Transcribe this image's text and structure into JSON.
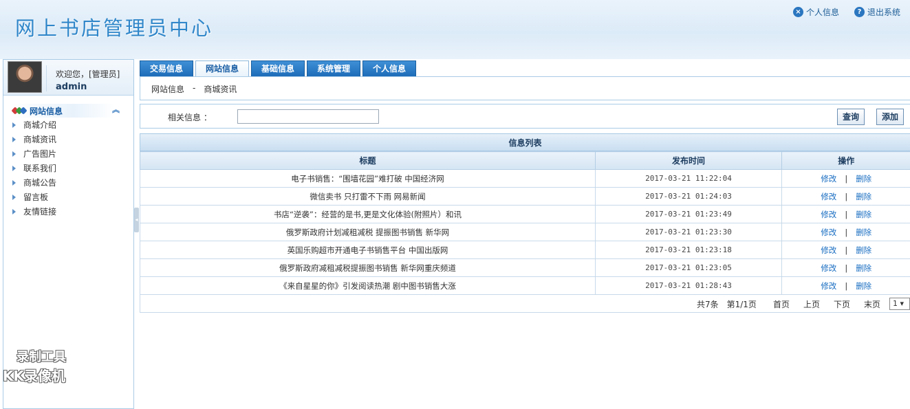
{
  "header": {
    "title": "网上书店管理员中心",
    "links": [
      {
        "label": "个人信息",
        "icon": "close-circle-icon"
      },
      {
        "label": "退出系统",
        "icon": "help-circle-icon"
      }
    ]
  },
  "user": {
    "welcome": "欢迎您，[管理员]",
    "name": "admin"
  },
  "sidebar": {
    "section": "网站信息",
    "items": [
      {
        "label": "商城介绍"
      },
      {
        "label": "商城资讯"
      },
      {
        "label": "广告图片"
      },
      {
        "label": "联系我们"
      },
      {
        "label": "商城公告"
      },
      {
        "label": "留言板"
      },
      {
        "label": "友情链接"
      }
    ]
  },
  "tabs": [
    {
      "label": "交易信息",
      "active": false
    },
    {
      "label": "网站信息",
      "active": true
    },
    {
      "label": "基础信息",
      "active": false
    },
    {
      "label": "系统管理",
      "active": false
    },
    {
      "label": "个人信息",
      "active": false
    }
  ],
  "breadcrumb": {
    "parent": "网站信息",
    "sep": "-",
    "current": "商城资讯"
  },
  "search": {
    "label": "相关信息 ：",
    "value": "",
    "query_label": "查询",
    "add_label": "添加"
  },
  "table": {
    "caption": "信息列表",
    "columns": [
      "标题",
      "发布时间",
      "操作"
    ],
    "rows": [
      {
        "title": "电子书销售：“围墙花园”难打破 中国经济网",
        "time": "2017-03-21 11:22:04"
      },
      {
        "title": "微信卖书 只打雷不下雨 网易新闻",
        "time": "2017-03-21 01:24:03"
      },
      {
        "title": "书店“逆袭”：经营的是书,更是文化体验(附照片）和讯",
        "time": "2017-03-21 01:23:49"
      },
      {
        "title": "俄罗斯政府计划减租减税 提振图书销售 新华网",
        "time": "2017-03-21 01:23:30"
      },
      {
        "title": "英国乐购超市开通电子书销售平台 中国出版网",
        "time": "2017-03-21 01:23:18"
      },
      {
        "title": "俄罗斯政府减租减税提振图书销售 新华网重庆频道",
        "time": "2017-03-21 01:23:05"
      },
      {
        "title": "《来自星星的你》引发阅读热潮 剧中图书销售大涨",
        "time": "2017-03-21 01:28:43"
      }
    ],
    "edit_label": "修改",
    "op_sep": "|",
    "delete_label": "删除"
  },
  "pager": {
    "total": "共7条",
    "page": "第1/1页",
    "first": "首页",
    "prev": "上页",
    "next": "下页",
    "last": "末页",
    "select_value": "1 ▾"
  },
  "watermark": {
    "line1": "录制工具",
    "line2": "KK录像机"
  },
  "colors": {
    "brand": "#2f86c9",
    "tab": "#1d6cb9",
    "link": "#1a6ec2"
  }
}
